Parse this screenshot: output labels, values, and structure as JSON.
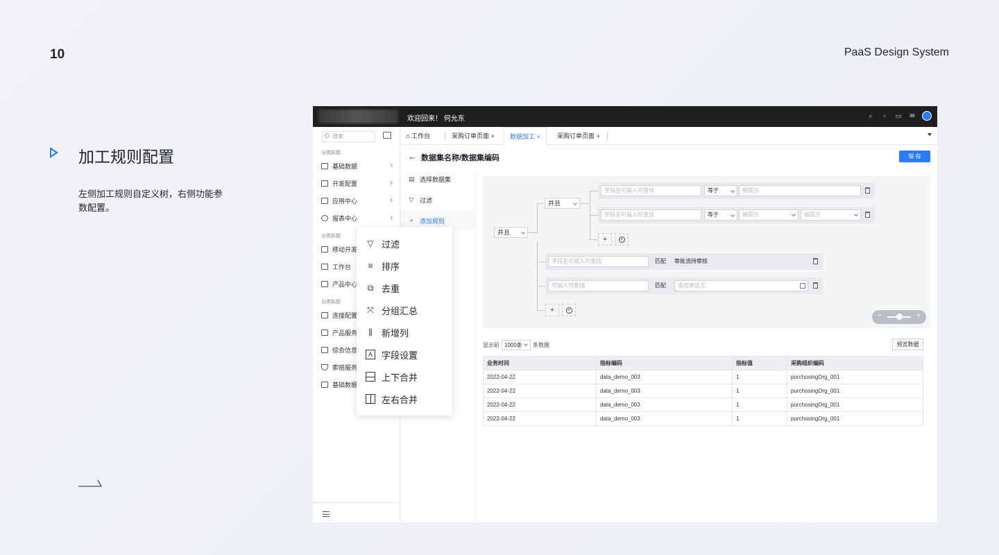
{
  "slide": {
    "page_number": "10",
    "brand": "PaaS Design System",
    "section_title": "加工规则配置",
    "section_desc": "左侧加工规则自定义树，右侧功能参数配置。"
  },
  "app": {
    "welcome": "欢迎回来！ 何允东",
    "top_icons": [
      "search-icon",
      "lock-icon",
      "inbox-icon",
      "mail-icon",
      "avatar"
    ],
    "sidebar": {
      "search_placeholder": "搜索",
      "cat1": "分类标题",
      "cat2": "分类标题",
      "cat3": "分类标题",
      "items": [
        {
          "label": "基础数据",
          "icon": "database-icon"
        },
        {
          "label": "开发配置",
          "icon": "code-icon"
        },
        {
          "label": "应用中心",
          "icon": "app-icon"
        },
        {
          "label": "报表中心",
          "icon": "chart-icon"
        },
        {
          "label": "移动开发",
          "icon": "mobile-icon"
        },
        {
          "label": "工作台",
          "icon": "monitor-icon"
        },
        {
          "label": "产品中心",
          "icon": "box-icon"
        },
        {
          "label": "连接配置",
          "icon": "link-icon"
        },
        {
          "label": "产品服务",
          "icon": "cube-icon"
        },
        {
          "label": "综合信息",
          "icon": "grid-icon"
        },
        {
          "label": "索赔服务",
          "icon": "shield-icon"
        },
        {
          "label": "基础数据",
          "icon": "database-icon"
        }
      ]
    },
    "tabs": [
      {
        "label": "工作台"
      },
      {
        "label": "采购订单页面"
      },
      {
        "label": "数据加工"
      },
      {
        "label": "采购订单页面"
      }
    ],
    "tab_close": "×",
    "page_title": "数据集名称/数据集编码",
    "save_label": "保 存",
    "steps": [
      {
        "label": "选择数据集"
      },
      {
        "label": "过滤"
      },
      {
        "label": "添加规则"
      }
    ],
    "rule": {
      "root_logic": "并且",
      "group_logic": "并且",
      "field_placeholder": "字段名可输入可查找",
      "op_equal": "等于",
      "hint_placeholder": "暗提示",
      "match_label": "匹配",
      "match_value": "审批流待审核",
      "input_placeholder": "可输入可查找",
      "expr_placeholder": "添加表达式",
      "plus": "+",
      "minus": "−"
    },
    "table": {
      "show_prefix": "显示前",
      "show_count": "1000条",
      "show_suffix": "条数据",
      "preview_label": "预览数据",
      "headers": [
        "业务时间",
        "指标编码",
        "指标值",
        "采购组织编码"
      ],
      "rows": [
        [
          "2022-04-22",
          "data_demo_003",
          "1",
          "purchosingOrg_001"
        ],
        [
          "2022-04-22",
          "data_demo_003",
          "1",
          "purchosingOrg_001"
        ],
        [
          "2022-04-22",
          "data_demo_003",
          "1",
          "purchosingOrg_001"
        ],
        [
          "2022-04-22",
          "data_demo_003",
          "1",
          "purchosingOrg_001"
        ]
      ]
    }
  },
  "menu": {
    "items": [
      {
        "label": "过滤",
        "icon": "filter-icon"
      },
      {
        "label": "排序",
        "icon": "sort-icon"
      },
      {
        "label": "去重",
        "icon": "dedupe-icon"
      },
      {
        "label": "分组汇总",
        "icon": "group-icon"
      },
      {
        "label": "新增列",
        "icon": "add-column-icon"
      },
      {
        "label": "字段设置",
        "icon": "field-icon"
      },
      {
        "label": "上下合并",
        "icon": "merge-vertical-icon"
      },
      {
        "label": "左右合并",
        "icon": "merge-horizontal-icon"
      }
    ]
  }
}
